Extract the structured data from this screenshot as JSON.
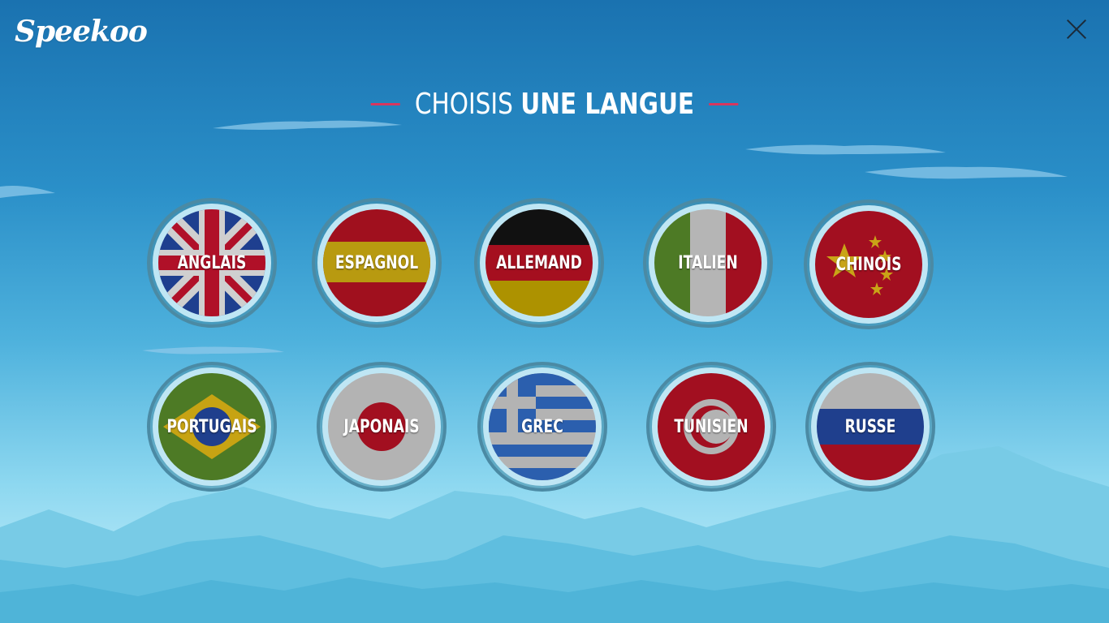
{
  "app": {
    "name": "Speekoo"
  },
  "header": {
    "title_light": "CHOISIS",
    "title_bold": "UNE LANGUE",
    "close_icon": "close-icon"
  },
  "colors": {
    "sky_top": "#1a72b0",
    "sky_bottom": "#c9f0fb",
    "accent_line": "#d8365e"
  },
  "languages": [
    {
      "label": "ANGLAIS"
    },
    {
      "label": "ESPAGNOL"
    },
    {
      "label": "ALLEMAND"
    },
    {
      "label": "ITALIEN"
    },
    {
      "label": "CHINOIS"
    },
    {
      "label": "PORTUGAIS"
    },
    {
      "label": "JAPONAIS"
    },
    {
      "label": "GREC"
    },
    {
      "label": "TUNISIEN"
    },
    {
      "label": "RUSSE"
    }
  ]
}
